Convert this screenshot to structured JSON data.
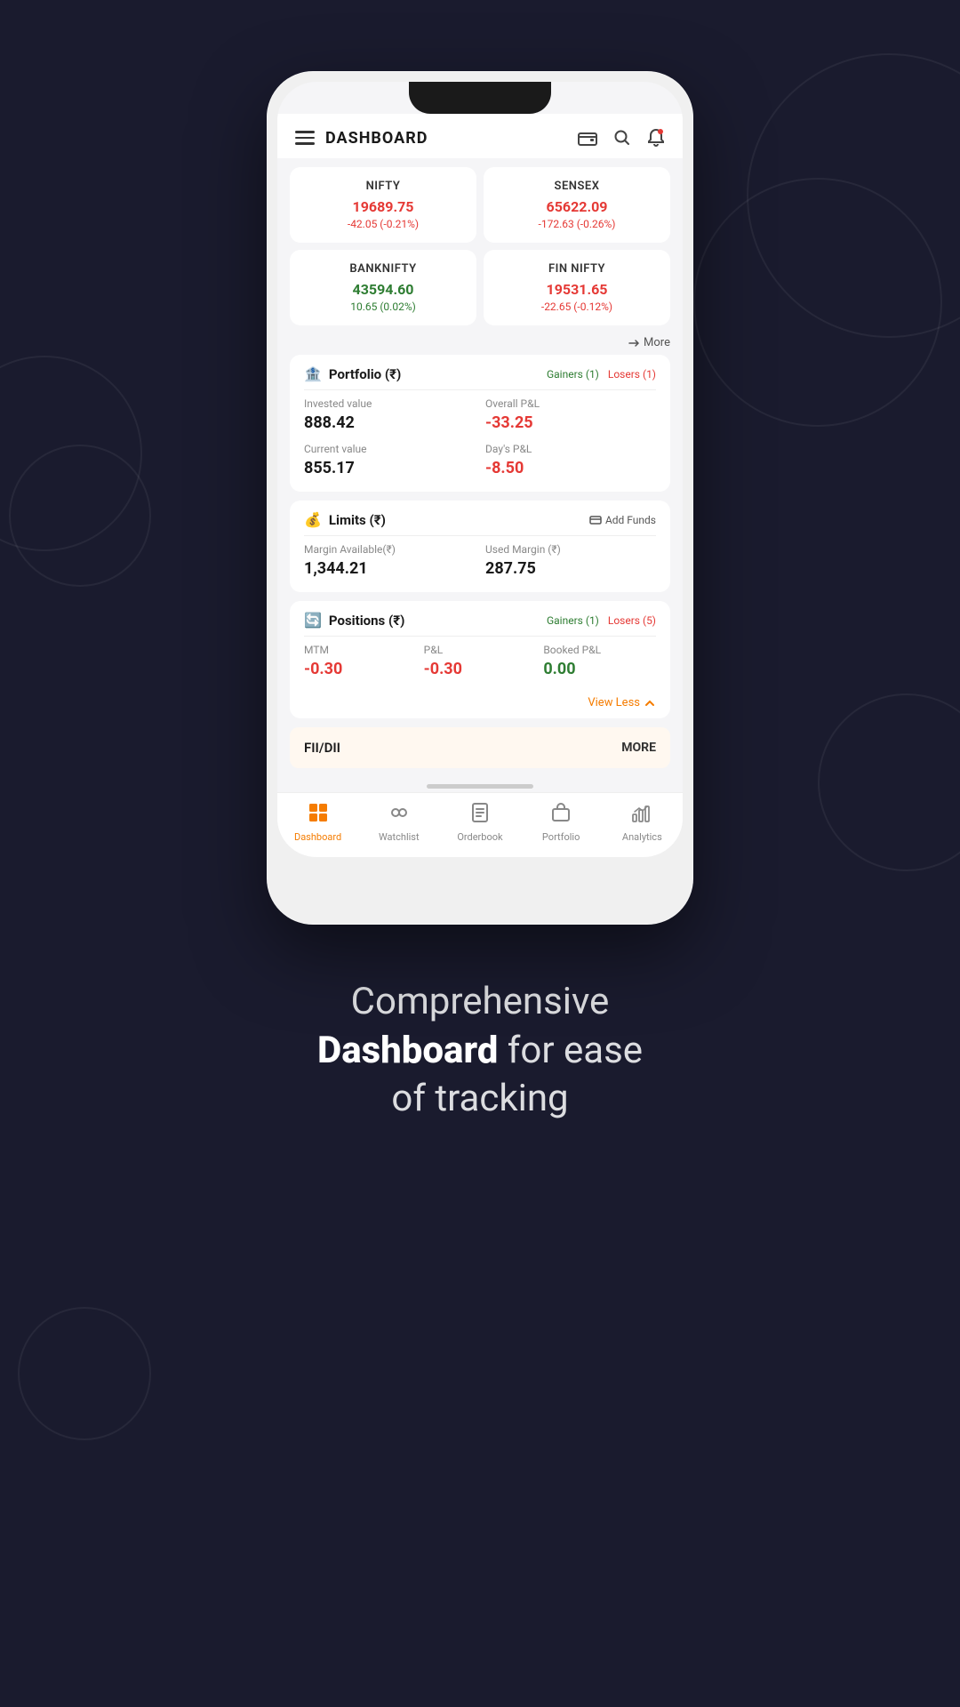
{
  "app": {
    "title": "DASHBOARD"
  },
  "market": {
    "items": [
      {
        "name": "NIFTY",
        "price": "19689.75",
        "change": "-42.05  (-0.21%)",
        "color": "red"
      },
      {
        "name": "SENSEX",
        "price": "65622.09",
        "change": "-172.63  (-0.26%)",
        "color": "red"
      },
      {
        "name": "BANKNIFTY",
        "price": "43594.60",
        "change": "10.65  (0.02%)",
        "color": "green"
      },
      {
        "name": "FIN NIFTY",
        "price": "19531.65",
        "change": "-22.65  (-0.12%)",
        "color": "red"
      }
    ],
    "more_label": "More"
  },
  "portfolio": {
    "title": "Portfolio (₹)",
    "gainers": "Gainers (1)",
    "losers": "Losers (1)",
    "invested_label": "Invested value",
    "invested_value": "888.42",
    "current_label": "Current value",
    "current_value": "855.17",
    "overall_pnl_label": "Overall P&L",
    "overall_pnl_value": "-33.25",
    "days_pnl_label": "Day's P&L",
    "days_pnl_value": "-8.50"
  },
  "limits": {
    "title": "Limits (₹)",
    "add_funds": "Add Funds",
    "margin_avail_label": "Margin Available(₹)",
    "margin_avail_value": "1,344.21",
    "used_margin_label": "Used Margin (₹)",
    "used_margin_value": "287.75"
  },
  "positions": {
    "title": "Positions (₹)",
    "gainers": "Gainers (1)",
    "losers": "Losers (5)",
    "mtm_label": "MTM",
    "mtm_value": "-0.30",
    "pnl_label": "P&L",
    "pnl_value": "-0.30",
    "booked_pnl_label": "Booked P&L",
    "booked_pnl_value": "0.00",
    "view_less": "View Less"
  },
  "fii_dii": {
    "label": "FII/DII",
    "more": "MORE"
  },
  "nav": {
    "items": [
      {
        "label": "Dashboard",
        "active": true
      },
      {
        "label": "Watchlist",
        "active": false
      },
      {
        "label": "Orderbook",
        "active": false
      },
      {
        "label": "Portfolio",
        "active": false
      },
      {
        "label": "Analytics",
        "active": false
      }
    ]
  },
  "footer": {
    "line1": "Comprehensive",
    "line2_bold": "Dashboard",
    "line2_rest": " for ease",
    "line3": "of tracking"
  }
}
